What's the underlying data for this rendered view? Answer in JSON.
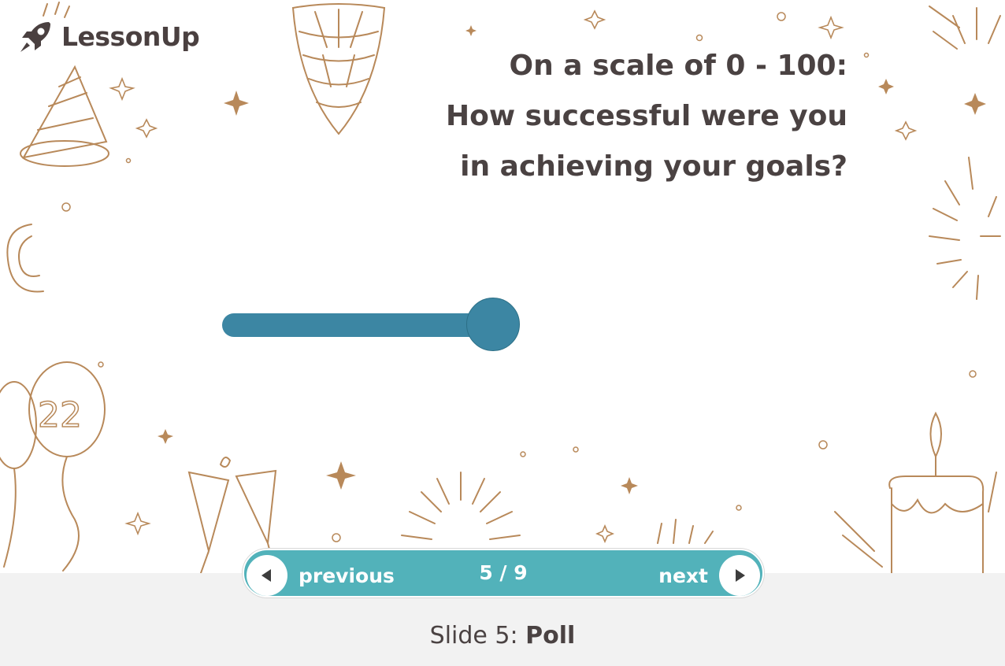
{
  "brand": {
    "name": "LessonUp",
    "icon": "rocket-icon"
  },
  "slide": {
    "question_lines": [
      "On a scale of 0 - 100:",
      "How successful were you",
      "in achieving your goals?"
    ],
    "slider_value_fraction": 0.9
  },
  "nav": {
    "previous_label": "previous",
    "next_label": "next",
    "counter": "5 / 9"
  },
  "caption": {
    "prefix": "Slide 5:",
    "type": "Poll"
  },
  "colors": {
    "accent": "#52b2ba",
    "slider": "#3c86a3",
    "text": "#4a4242",
    "decoration": "#b8895a"
  }
}
